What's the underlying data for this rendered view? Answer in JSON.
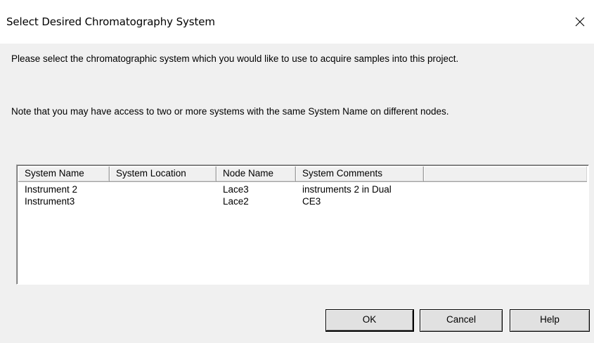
{
  "window": {
    "title": "Select Desired Chromatography System",
    "close_icon": "close-icon"
  },
  "messages": {
    "instruction": "Please select the chromatographic system which you would like to use to acquire samples into this project.",
    "note": "Note that you may have access to two or more systems with the same System Name on different nodes."
  },
  "systems_table": {
    "columns": [
      "System Name",
      "System Location",
      "Node Name",
      "System Comments"
    ],
    "rows": [
      {
        "name": "Instrument 2",
        "location": "",
        "node": "Lace3",
        "comments": "instruments 2 in Dual"
      },
      {
        "name": "Instrument3",
        "location": "",
        "node": "Lace2",
        "comments": "CE3"
      }
    ]
  },
  "buttons": {
    "ok": "OK",
    "cancel": "Cancel",
    "help": "Help"
  }
}
